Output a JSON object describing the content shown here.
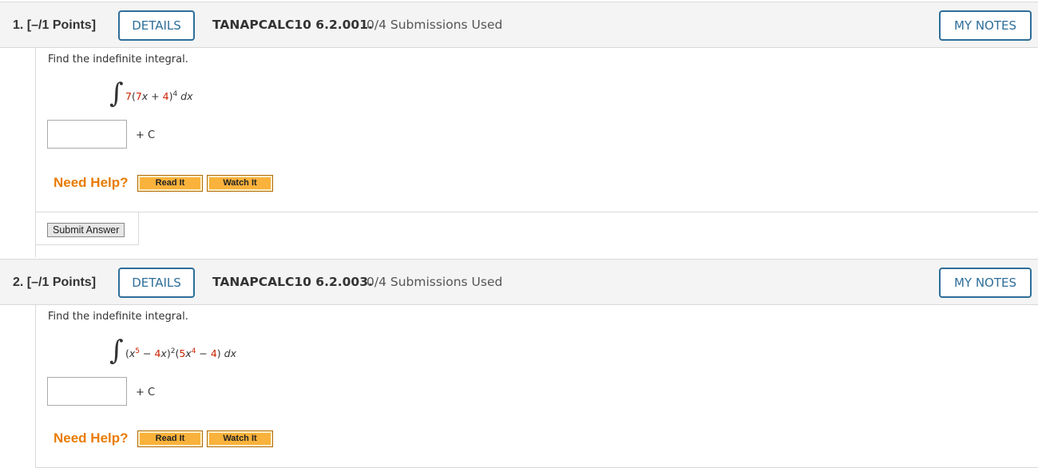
{
  "questions": [
    {
      "number": "1.",
      "points": "[–/1 Points]",
      "details_label": "DETAILS",
      "code": "TANAPCALC10 6.2.001.",
      "submissions": "0/4 Submissions Used",
      "notes_label": "MY NOTES",
      "prompt": "Find the indefinite integral.",
      "integral_sign": "∫",
      "integrand": {
        "coef": "7",
        "open": "(",
        "inner_coef": "7",
        "var": "x",
        "plus": " + ",
        "const": "4",
        "close": ")",
        "exp": "4",
        "dx": " dx"
      },
      "answer_value": "",
      "plus_c": "+ C",
      "need_help": "Need Help?",
      "read_it": "Read It",
      "watch_it": "Watch It",
      "submit_label": "Submit Answer"
    },
    {
      "number": "2.",
      "points": "[–/1 Points]",
      "details_label": "DETAILS",
      "code": "TANAPCALC10 6.2.003.",
      "submissions": "0/4 Submissions Used",
      "notes_label": "MY NOTES",
      "prompt": "Find the indefinite integral.",
      "integral_sign": "∫",
      "integrand": {
        "open1": "(",
        "x1": "x",
        "exp1": "5",
        "minus1": " − ",
        "c1": "4",
        "x2": "x",
        "close1": ")",
        "exp2": "2",
        "open2": "(",
        "c2": "5",
        "x3": "x",
        "exp3": "4",
        "minus2": " − ",
        "c3": "4",
        "close2": ")",
        "dx": " dx"
      },
      "answer_value": "",
      "plus_c": "+ C",
      "need_help": "Need Help?",
      "read_it": "Read It",
      "watch_it": "Watch It"
    }
  ],
  "colors": {
    "accent_blue": "#2e6e99",
    "help_orange": "#e87b00",
    "button_orange": "#f9b23b",
    "math_red": "#cc2200"
  }
}
